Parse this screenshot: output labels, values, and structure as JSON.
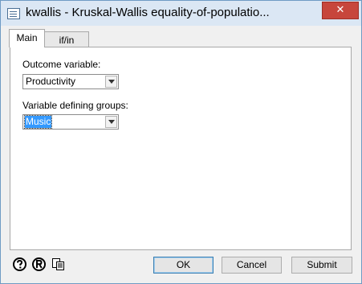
{
  "window": {
    "title": "kwallis - Kruskal-Wallis equality-of-populatio..."
  },
  "titlebar": {
    "close_glyph": "✕"
  },
  "tabs": [
    {
      "label": "Main",
      "active": true
    },
    {
      "label": "if/in",
      "active": false
    }
  ],
  "main": {
    "outcome_label": "Outcome variable:",
    "outcome_value": "Productivity",
    "groups_label": "Variable defining groups:",
    "groups_value": "Music"
  },
  "footer": {
    "icons": [
      "help-icon",
      "reset-icon",
      "copy-command-icon"
    ],
    "ok_label": "OK",
    "cancel_label": "Cancel",
    "submit_label": "Submit"
  },
  "colors": {
    "titlebar": "#dbe7f4",
    "close": "#c7463c",
    "selection": "#3399ff"
  }
}
